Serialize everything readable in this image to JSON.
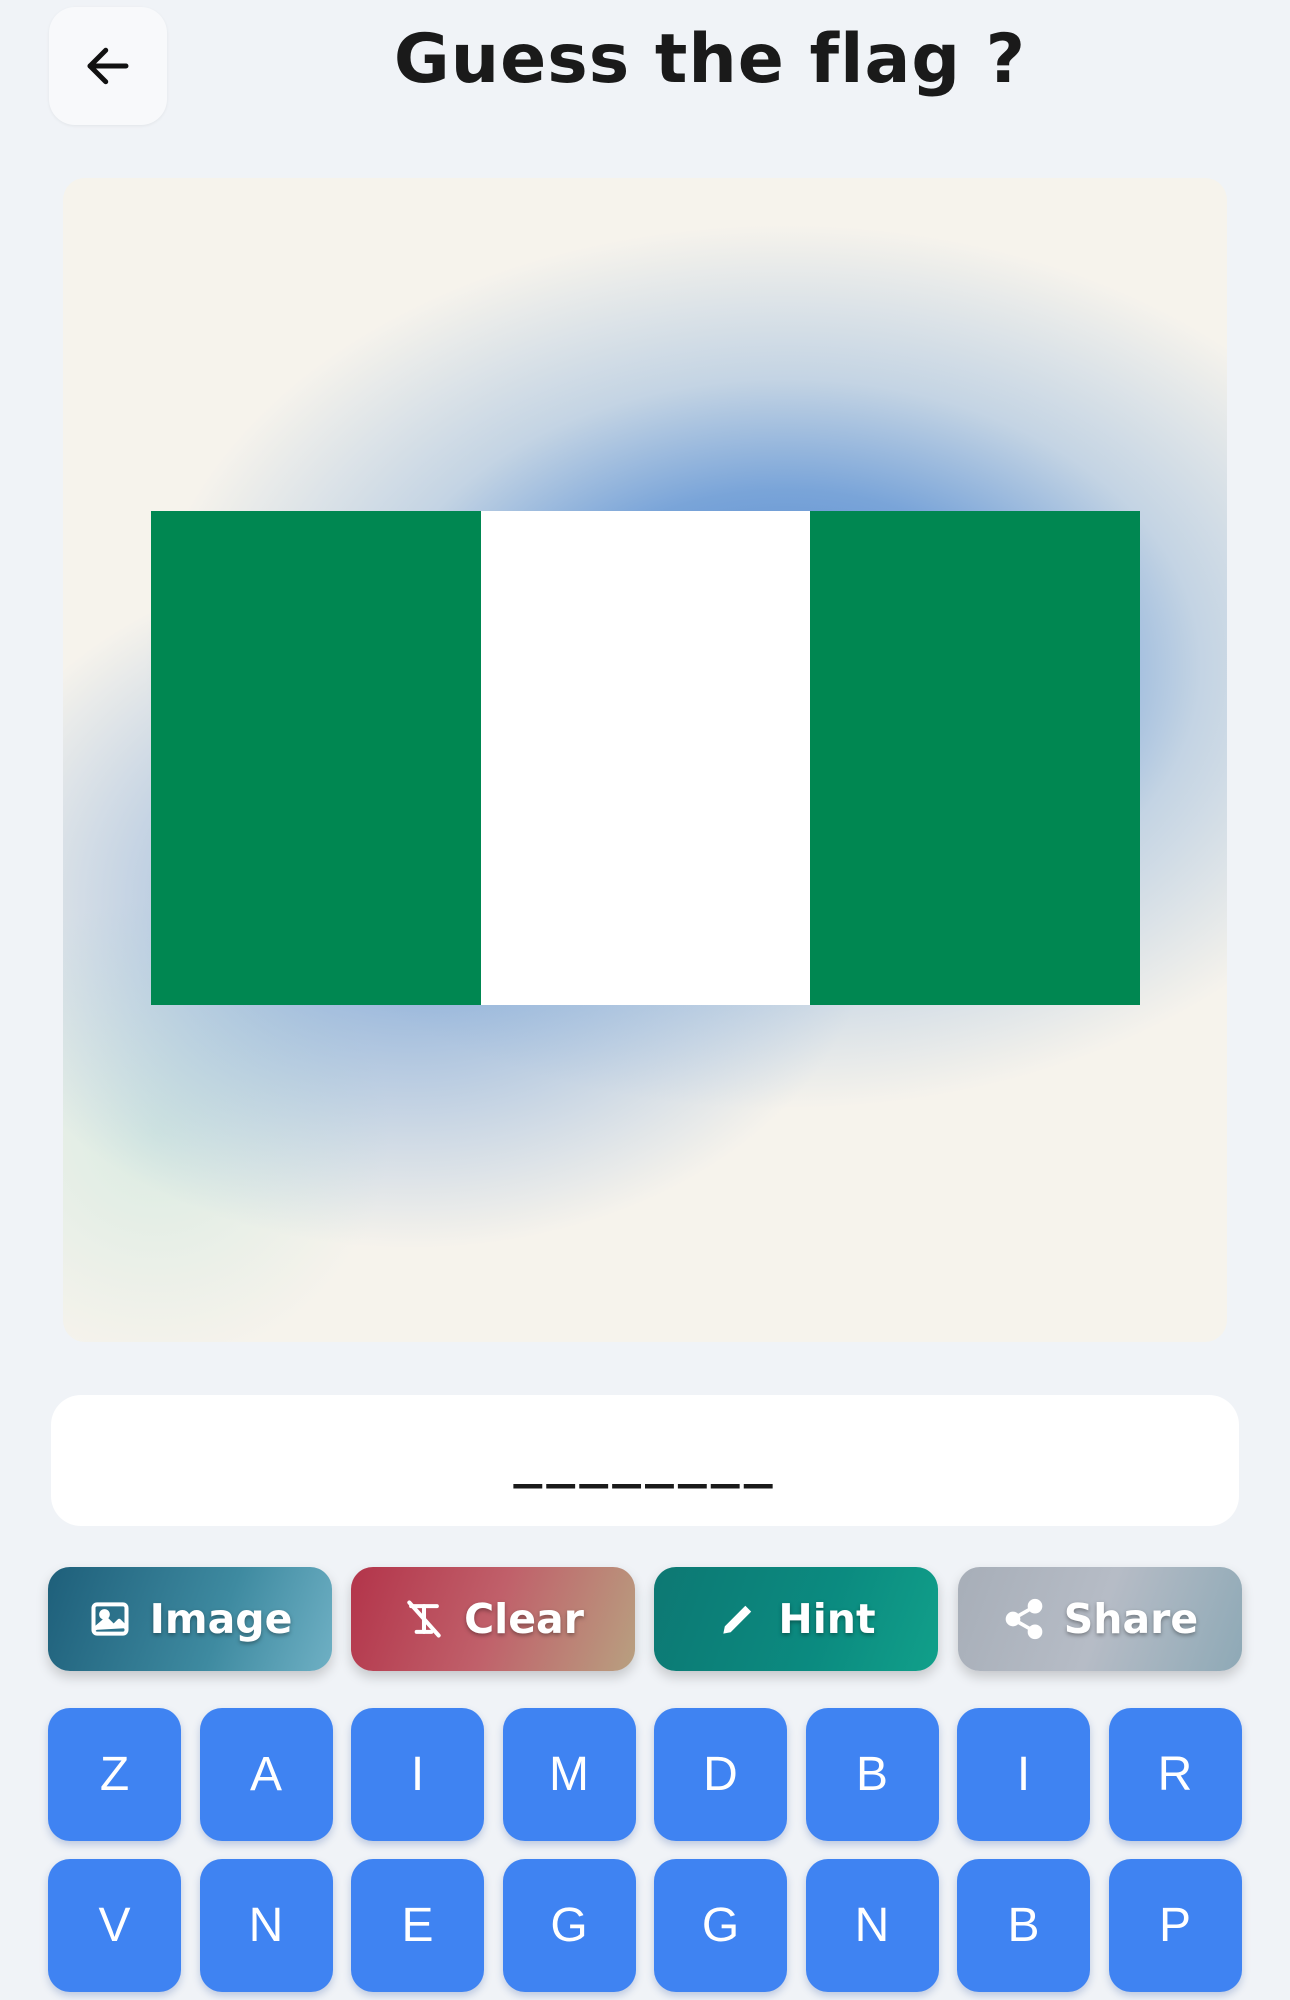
{
  "header": {
    "title": "Guess the flag ?"
  },
  "flag": {
    "colors": [
      "#008751",
      "#ffffff",
      "#008751"
    ]
  },
  "answer": {
    "slots": "________"
  },
  "actions": [
    {
      "id": "image",
      "label": "Image",
      "icon": "image-icon"
    },
    {
      "id": "clear",
      "label": "Clear",
      "icon": "clear-format-icon"
    },
    {
      "id": "hint",
      "label": "Hint",
      "icon": "pencil-icon"
    },
    {
      "id": "share",
      "label": "Share",
      "icon": "share-icon"
    }
  ],
  "keyboard": {
    "rows": [
      [
        "Z",
        "A",
        "I",
        "M",
        "D",
        "B",
        "I",
        "R"
      ],
      [
        "V",
        "N",
        "E",
        "G",
        "G",
        "N",
        "B",
        "P"
      ]
    ]
  },
  "colors": {
    "key": "#3f83f2",
    "background": "#f0f3f7"
  }
}
